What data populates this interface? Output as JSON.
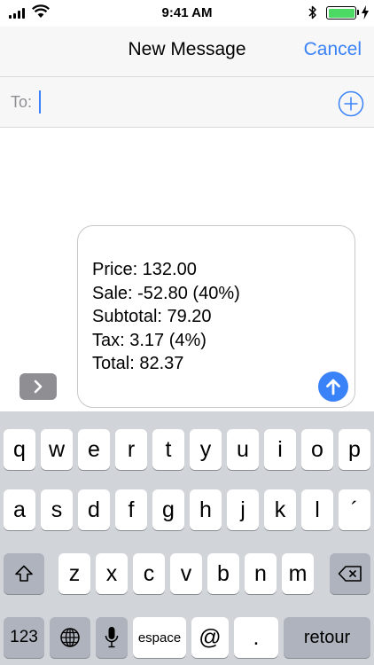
{
  "status_bar": {
    "time": "9:41 AM",
    "battery_level": 1.0,
    "icons": [
      "signal-icon",
      "wifi-icon",
      "bluetooth-icon",
      "battery-icon",
      "charging-icon"
    ]
  },
  "nav": {
    "title": "New Message",
    "cancel_label": "Cancel"
  },
  "to_field": {
    "label": "To:",
    "value": "",
    "add_icon": "plus-circle-icon"
  },
  "message": {
    "lines": [
      "Price: 132.00",
      "Sale: -52.80 (40%)",
      "Subtotal: 79.20",
      "Tax: 3.17 (4%)",
      "Total: 82.37"
    ],
    "send_icon": "arrow-up-icon",
    "apps_icon": "chevron-right-icon"
  },
  "keyboard": {
    "row1": [
      "q",
      "w",
      "e",
      "r",
      "t",
      "y",
      "u",
      "i",
      "o",
      "p"
    ],
    "row2": [
      "a",
      "s",
      "d",
      "f",
      "g",
      "h",
      "j",
      "k",
      "l",
      "´"
    ],
    "row3": [
      "z",
      "x",
      "c",
      "v",
      "b",
      "n",
      "m"
    ],
    "numbers_label": "123",
    "space_label": "espace",
    "at_label": "@",
    "period_label": ".",
    "return_label": "retour",
    "shift_icon": "shift-icon",
    "delete_icon": "delete-icon",
    "globe_icon": "globe-icon",
    "mic_icon": "microphone-icon"
  },
  "colors": {
    "accent": "#3a82f7",
    "battery": "#4cd964",
    "keyboard_bg": "#d1d4d9",
    "dark_key": "#aeb3bd"
  }
}
